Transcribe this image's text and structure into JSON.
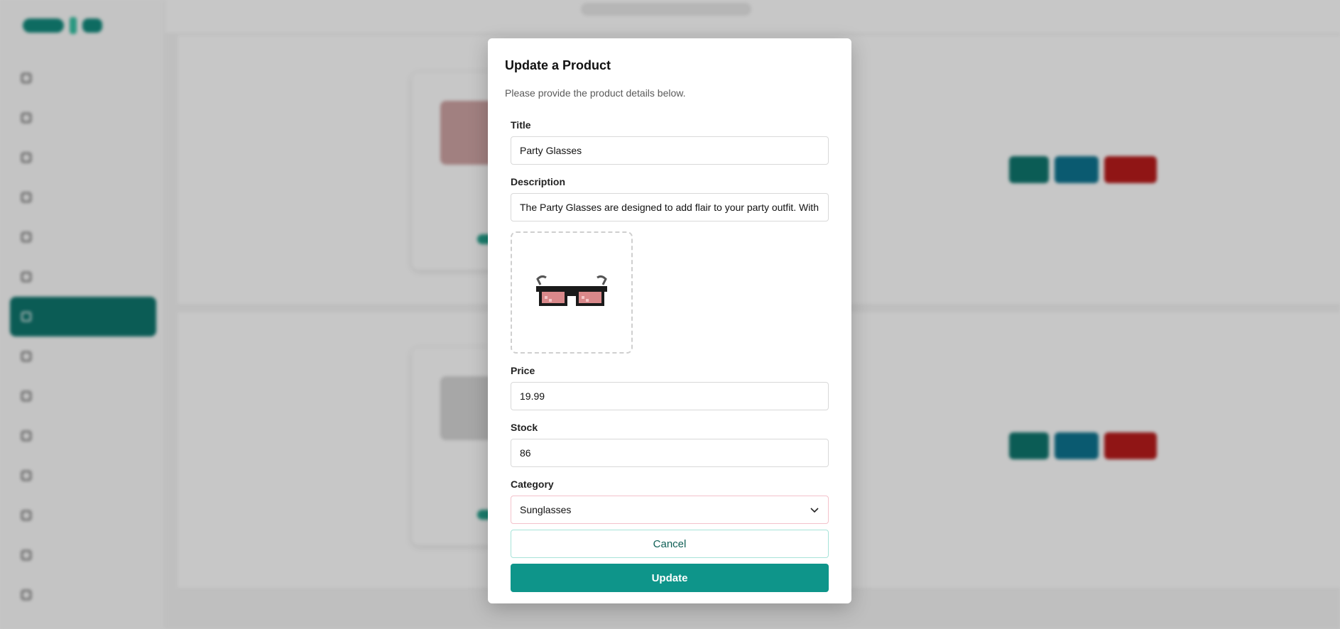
{
  "modal": {
    "title": "Update a Product",
    "subtitle": "Please provide the product details below.",
    "title_label": "Title",
    "title_value": "Party Glasses",
    "description_label": "Description",
    "description_value": "The Party Glasses are designed to add flair to your party outfit. With",
    "image_alt": "glasses",
    "price_label": "Price",
    "price_value": "19.99",
    "stock_label": "Stock",
    "stock_value": "86",
    "category_label": "Category",
    "category_value": "Sunglasses",
    "cancel_label": "Cancel",
    "update_label": "Update"
  },
  "colors": {
    "accent": "#0e958a",
    "sidebar_active": "#0f766e",
    "delete": "#b91c1c",
    "view": "#0e7490"
  },
  "icons": [
    "chevron-down-icon",
    "glasses-image"
  ]
}
